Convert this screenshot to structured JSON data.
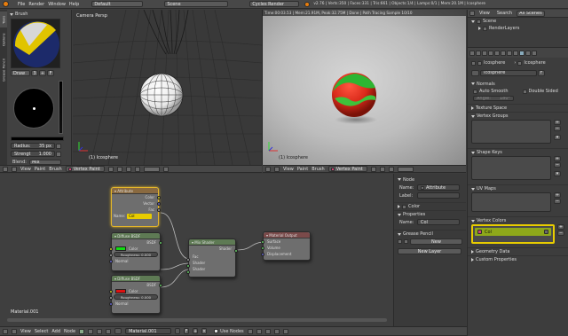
{
  "info_header": {
    "menus": [
      "File",
      "Render",
      "Window",
      "Help"
    ],
    "layout": "Default",
    "scene": "Scene",
    "engine": "Cycles Render",
    "stats": "v2.76 | Verts:350 | Faces:331 | Tris:661 | Objects:1/4 | Lamps:0/1 | Mem:20.1M | Icosphere"
  },
  "toolshelf": {
    "tabs": [
      "Tools",
      "Options",
      "Grease Pencil"
    ],
    "brush_header": "Brush",
    "draw_label": "Draw",
    "draw_number": "3",
    "radius_label": "Radius:",
    "radius_value": "35 px",
    "strength_label": "Strengt",
    "strength_value": "1.000",
    "blend_label": "Blend:",
    "blend_value": "Mix"
  },
  "viewport_left": {
    "view_label": "Camera Persp",
    "object_label": "(1) Icosphere",
    "menus": [
      "View",
      "Paint",
      "Brush"
    ],
    "mode": "Vertex Paint"
  },
  "viewport_right": {
    "render_info": "Time:00:03.53 | Mem:21.91M, Peak:32.75M | Done | Path Tracing Sample 10/10",
    "object_label": "(1) Icosphere",
    "menus": [
      "View",
      "Paint",
      "Brush"
    ],
    "mode": "Vertex Paint"
  },
  "outliner": {
    "tabs": [
      "View",
      "Search",
      "All Scenes"
    ],
    "items": [
      "Scene",
      "RenderLayers"
    ]
  },
  "properties": {
    "object_name": "Icosphere",
    "breadcrumb_obj": "Icosphere",
    "data_name": "Icosphere",
    "normals_header": "Normals",
    "auto_smooth": "Auto Smooth",
    "double_sided": "Double Sided",
    "angle_label": "Angle:",
    "angle_value": "180°",
    "texture_space": "Texture Space",
    "vertex_groups": "Vertex Groups",
    "shape_keys": "Shape Keys",
    "uv_maps": "UV Maps",
    "vertex_colors": "Vertex Colors",
    "vc_item": "Col",
    "geometry_data": "Geometry Data",
    "custom_properties": "Custom Properties"
  },
  "node_editor": {
    "material_label": "Material.001",
    "menus": [
      "View",
      "Select",
      "Add",
      "Node"
    ],
    "material_field": "Material.001",
    "use_nodes": "Use Nodes",
    "nodes": {
      "attribute": {
        "title": "Attribute",
        "outputs": [
          "Color",
          "Vector",
          "Fac"
        ],
        "name_label": "Name:",
        "name_value": "Col"
      },
      "diffuse1": {
        "title": "Diffuse BSDF",
        "output": "BSDF",
        "color": "Color",
        "roughness": "Roughness: 0.000",
        "normal": "Normal",
        "swatch": "#11dd11"
      },
      "diffuse2": {
        "title": "Diffuse BSDF",
        "output": "BSDF",
        "color": "Color",
        "roughness": "Roughness: 0.000",
        "normal": "Normal",
        "swatch": "#dd1111"
      },
      "mix": {
        "title": "Mix Shader",
        "output": "Shader",
        "fac": "Fac",
        "shader1": "Shader",
        "shader2": "Shader"
      },
      "output": {
        "title": "Material Output",
        "inputs": [
          "Surface",
          "Volume",
          "Displacement"
        ]
      }
    }
  },
  "node_sidebar": {
    "node_header": "Node",
    "name_label": "Name:",
    "name_value": "Attribute",
    "label_label": "Label:",
    "color_header": "Color",
    "properties_header": "Properties",
    "prop_name_label": "Name:",
    "prop_name_value": "Col",
    "grease_pencil_header": "Grease Pencil",
    "new_button": "New",
    "new_layer_button": "New Layer"
  }
}
